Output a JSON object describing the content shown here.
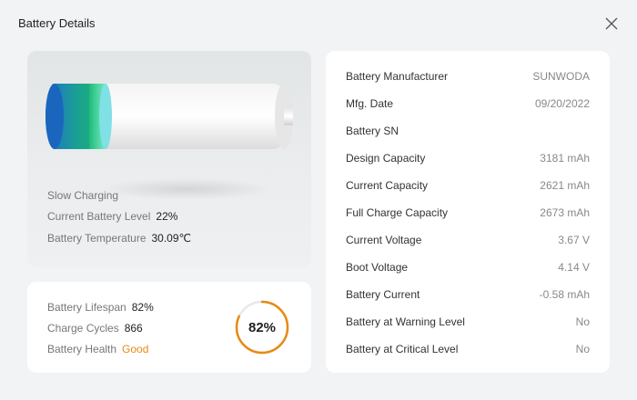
{
  "window": {
    "title": "Battery Details"
  },
  "status": {
    "charging_label": "Slow Charging",
    "level_label": "Current Battery Level",
    "level_value": "22%",
    "temp_label": "Battery Temperature",
    "temp_value": "30.09℃",
    "level_fraction": 0.22
  },
  "health": {
    "lifespan_label": "Battery Lifespan",
    "lifespan_value": "82%",
    "cycles_label": "Charge Cycles",
    "cycles_value": "866",
    "health_label": "Battery Health",
    "health_value": "Good",
    "ring_value": "82%",
    "ring_fraction": 0.82,
    "accent": "#e88a12"
  },
  "details": {
    "rows": [
      {
        "label": "Battery Manufacturer",
        "value": "SUNWODA"
      },
      {
        "label": "Mfg. Date",
        "value": "09/20/2022"
      },
      {
        "label": "Battery SN",
        "value": ""
      },
      {
        "label": "Design Capacity",
        "value": "3181 mAh"
      },
      {
        "label": "Current Capacity",
        "value": "2621 mAh"
      },
      {
        "label": "Full Charge Capacity",
        "value": "2673 mAh"
      },
      {
        "label": "Current Voltage",
        "value": "3.67 V"
      },
      {
        "label": "Boot Voltage",
        "value": "4.14 V"
      },
      {
        "label": "Battery Current",
        "value": "-0.58 mAh"
      },
      {
        "label": "Battery at Warning Level",
        "value": "No"
      },
      {
        "label": "Battery at Critical Level",
        "value": "No"
      }
    ]
  }
}
